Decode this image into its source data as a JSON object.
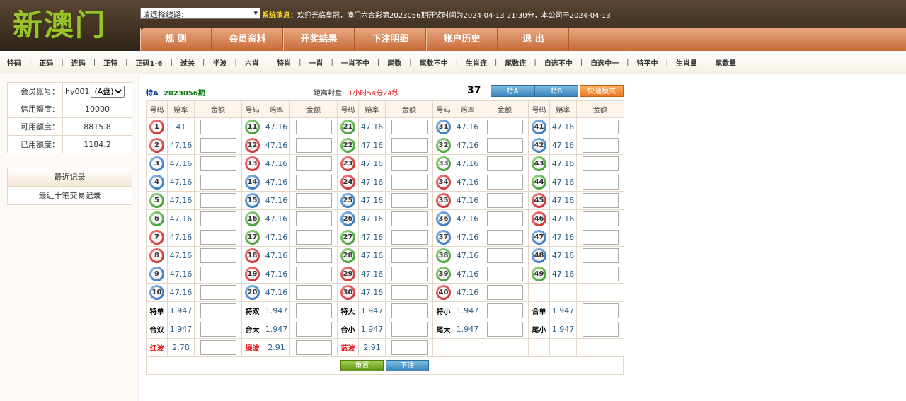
{
  "header": {
    "logo_text": "新澳门",
    "line_select": "请选择线路:",
    "notice_label": "系统消息：",
    "notice_text": "欢迎光临皇冠，澳门六合彩第2023056期开奖时间为2024-04-13 21:30分，本公司于2024-04-13",
    "nav": [
      "规 则",
      "会员资料",
      "开奖结果",
      "下注明细",
      "账户历史",
      "退 出"
    ]
  },
  "subnav": [
    "特码",
    "正码",
    "连码",
    "正特",
    "正码1-6",
    "过关",
    "半波",
    "六肖",
    "特肖",
    "一肖",
    "一肖不中",
    "尾数",
    "尾数不中",
    "生肖连",
    "尾数连",
    "自选不中",
    "自选中一",
    "特平中",
    "生肖量",
    "尾数量"
  ],
  "account": {
    "id_label": "会员账号：",
    "id_value": "hy001",
    "plate_value": "(A盘)",
    "credit_label": "信用额度：",
    "credit_value": "10000",
    "available_label": "可用额度：",
    "available_value": "8815.8",
    "used_label": "已用额度：",
    "used_value": "1184.2"
  },
  "recent": {
    "title": "最近记录",
    "link": "最近十笔交易记录"
  },
  "bet": {
    "play": "特A",
    "issue": "2023056期",
    "countdown_label": "距离封盘:",
    "countdown_value": "1小时54分24秒",
    "count": "37",
    "btn_tea": "特A",
    "btn_teb": "特B",
    "btn_fast": "快速模式",
    "headers": [
      "号码",
      "赔率",
      "金额",
      "号码",
      "赔率",
      "金额",
      "号码",
      "赔率",
      "金额",
      "号码",
      "赔率",
      "金额",
      "号码",
      "赔率",
      "金额"
    ],
    "colors": {
      "red": "#c81414",
      "blue": "#1d62b0",
      "green": "#268c1c",
      "accent": "#c86a38"
    },
    "rows": [
      [
        {
          "n": "1",
          "c": "red",
          "o": "41"
        },
        {
          "n": "11",
          "c": "green",
          "o": "47.16"
        },
        {
          "n": "21",
          "c": "green",
          "o": "47.16"
        },
        {
          "n": "31",
          "c": "blue",
          "o": "47.16"
        },
        {
          "n": "41",
          "c": "blue",
          "o": "47.16"
        }
      ],
      [
        {
          "n": "2",
          "c": "red",
          "o": "47.16"
        },
        {
          "n": "12",
          "c": "red",
          "o": "47.16"
        },
        {
          "n": "22",
          "c": "green",
          "o": "47.16"
        },
        {
          "n": "32",
          "c": "green",
          "o": "47.16"
        },
        {
          "n": "42",
          "c": "blue",
          "o": "47.16"
        }
      ],
      [
        {
          "n": "3",
          "c": "blue",
          "o": "47.16"
        },
        {
          "n": "13",
          "c": "red",
          "o": "47.16"
        },
        {
          "n": "23",
          "c": "red",
          "o": "47.16"
        },
        {
          "n": "33",
          "c": "green",
          "o": "47.16"
        },
        {
          "n": "43",
          "c": "green",
          "o": "47.16"
        }
      ],
      [
        {
          "n": "4",
          "c": "blue",
          "o": "47.16"
        },
        {
          "n": "14",
          "c": "blue",
          "o": "47.16"
        },
        {
          "n": "24",
          "c": "red",
          "o": "47.16"
        },
        {
          "n": "34",
          "c": "red",
          "o": "47.16"
        },
        {
          "n": "44",
          "c": "green",
          "o": "47.16"
        }
      ],
      [
        {
          "n": "5",
          "c": "green",
          "o": "47.16"
        },
        {
          "n": "15",
          "c": "blue",
          "o": "47.16"
        },
        {
          "n": "25",
          "c": "blue",
          "o": "47.16"
        },
        {
          "n": "35",
          "c": "red",
          "o": "47.16"
        },
        {
          "n": "45",
          "c": "red",
          "o": "47.16"
        }
      ],
      [
        {
          "n": "6",
          "c": "green",
          "o": "47.16"
        },
        {
          "n": "16",
          "c": "green",
          "o": "47.16"
        },
        {
          "n": "26",
          "c": "blue",
          "o": "47.16"
        },
        {
          "n": "36",
          "c": "blue",
          "o": "47.16"
        },
        {
          "n": "46",
          "c": "red",
          "o": "47.16"
        }
      ],
      [
        {
          "n": "7",
          "c": "red",
          "o": "47.16"
        },
        {
          "n": "17",
          "c": "green",
          "o": "47.16"
        },
        {
          "n": "27",
          "c": "green",
          "o": "47.16"
        },
        {
          "n": "37",
          "c": "blue",
          "o": "47.16"
        },
        {
          "n": "47",
          "c": "blue",
          "o": "47.16"
        }
      ],
      [
        {
          "n": "8",
          "c": "red",
          "o": "47.16"
        },
        {
          "n": "18",
          "c": "red",
          "o": "47.16"
        },
        {
          "n": "28",
          "c": "green",
          "o": "47.16"
        },
        {
          "n": "38",
          "c": "green",
          "o": "47.16"
        },
        {
          "n": "48",
          "c": "blue",
          "o": "47.16"
        }
      ],
      [
        {
          "n": "9",
          "c": "blue",
          "o": "47.16"
        },
        {
          "n": "19",
          "c": "red",
          "o": "47.16"
        },
        {
          "n": "29",
          "c": "red",
          "o": "47.16"
        },
        {
          "n": "39",
          "c": "green",
          "o": "47.16"
        },
        {
          "n": "49",
          "c": "green",
          "o": "47.16"
        }
      ],
      [
        {
          "n": "10",
          "c": "blue",
          "o": "47.16"
        },
        {
          "n": "20",
          "c": "blue",
          "o": "47.16"
        },
        {
          "n": "30",
          "c": "red",
          "o": "47.16"
        },
        {
          "n": "40",
          "c": "red",
          "o": "47.16"
        },
        null
      ]
    ],
    "extra_rows": [
      [
        {
          "l": "特单",
          "o": "1.947"
        },
        {
          "l": "特双",
          "o": "1.947"
        },
        {
          "l": "特大",
          "o": "1.947"
        },
        {
          "l": "特小",
          "o": "1.947"
        },
        {
          "l": "合单",
          "o": "1.947"
        }
      ],
      [
        {
          "l": "合双",
          "o": "1.947"
        },
        {
          "l": "合大",
          "o": "1.947"
        },
        {
          "l": "合小",
          "o": "1.947"
        },
        {
          "l": "尾大",
          "o": "1.947"
        },
        {
          "l": "尾小",
          "o": "1.947"
        }
      ],
      [
        {
          "l": "红波",
          "o": "2.78",
          "c": "red"
        },
        {
          "l": "绿波",
          "o": "2.91",
          "c": "green"
        },
        {
          "l": "蓝波",
          "o": "2.91",
          "c": "blue"
        },
        null,
        null
      ]
    ],
    "btn_reset": "重置",
    "btn_submit": "下注"
  }
}
